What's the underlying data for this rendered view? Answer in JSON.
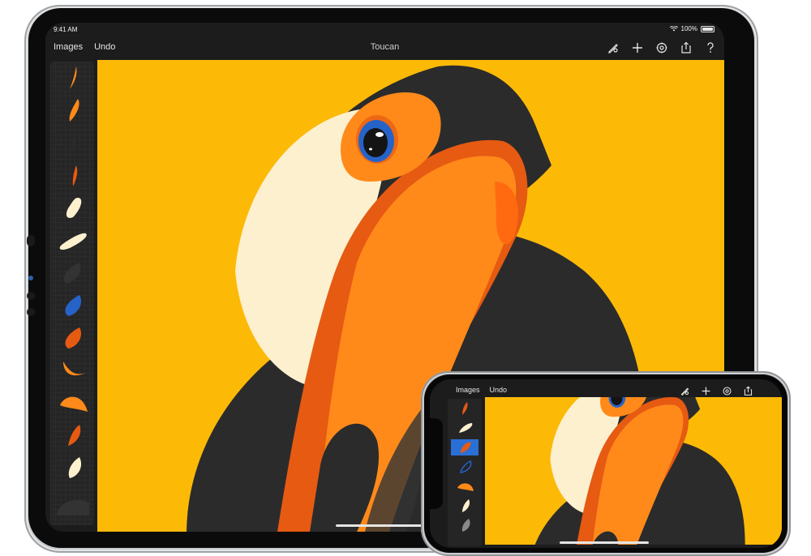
{
  "ipad": {
    "status": {
      "time": "9:41 AM",
      "battery": "100%"
    },
    "toolbar": {
      "images_label": "Images",
      "undo_label": "Undo",
      "title": "Toucan",
      "icons": [
        "brush-icon",
        "plus-icon",
        "gear-icon",
        "share-icon",
        "help-icon"
      ]
    },
    "layers": {
      "count": 14
    }
  },
  "iphone": {
    "toolbar": {
      "images_label": "Images",
      "undo_label": "Undo",
      "icons": [
        "brush-icon",
        "plus-icon",
        "gear-icon",
        "share-icon"
      ]
    }
  },
  "colors": {
    "canvas_bg": "#fcba07",
    "body_black": "#2b2b2b",
    "cream": "#fdf0cf",
    "orange": "#ff8a1a",
    "orange_dark": "#e65a12",
    "eye_blue": "#2563c9",
    "ui_dark": "#1c1c1d"
  }
}
